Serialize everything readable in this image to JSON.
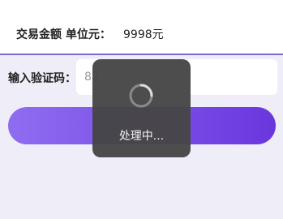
{
  "amount": {
    "label": "交易金额 单位元：",
    "value": "9998元"
  },
  "verification": {
    "label": "输入验证码：",
    "value": "82"
  },
  "loading": {
    "text": "处理中..."
  },
  "colors": {
    "background": "#efedf7",
    "divider": "#7a6ad8",
    "button_start": "#8f6df0",
    "button_end": "#6a36de",
    "overlay": "#464646"
  }
}
